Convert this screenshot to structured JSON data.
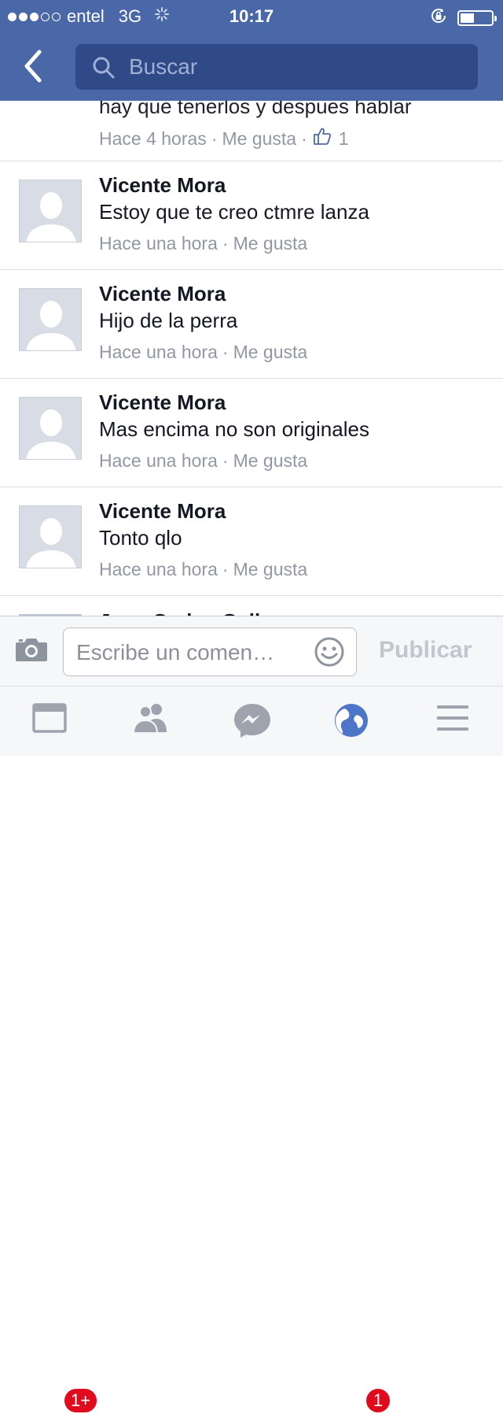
{
  "status_bar": {
    "carrier": "entel",
    "network": "3G",
    "time": "10:17",
    "signal_bars_filled": 3,
    "signal_bars_total": 5,
    "battery_level": 0.45
  },
  "nav": {
    "search_placeholder": "Buscar"
  },
  "first_comment": {
    "text": "hay que tenerlos y despues hablar",
    "time": "Hace 4 horas",
    "like_label": "Me gusta",
    "like_count": "1"
  },
  "comments": [
    {
      "author": "Vicente Mora",
      "text": "Estoy que te creo ctmre lanza",
      "time": "Hace una hora",
      "like_label": "Me gusta"
    },
    {
      "author": "Vicente Mora",
      "text": "Hijo de la perra",
      "time": "Hace una hora",
      "like_label": "Me gusta"
    },
    {
      "author": "Vicente Mora",
      "text": "Mas encima no son originales",
      "time": "Hace una hora",
      "like_label": "Me gusta"
    },
    {
      "author": "Vicente Mora",
      "text": "Tonto qlo",
      "time": "Hace una hora",
      "like_label": "Me gusta"
    }
  ],
  "partial_next": {
    "author_fragment": "Juan Carlos Galla"
  },
  "composer": {
    "placeholder": "Escribe un comen…",
    "publish_label": "Publicar"
  },
  "tab_bar": {
    "news_feed_badge": "1+",
    "notifications_badge": "1"
  },
  "colors": {
    "brand": "#4a67a8",
    "search_field": "#2f4a86",
    "meta_text": "#9197a3",
    "badge": "#e00c1d",
    "like_icon": "#4e69a2"
  },
  "icons": [
    "back-arrow-icon",
    "search-icon",
    "camera-icon",
    "smiley-icon",
    "news-feed-icon",
    "friends-icon",
    "messenger-icon",
    "globe-icon",
    "menu-icon",
    "thumbs-up-icon",
    "orientation-lock-icon",
    "activity-spinner-icon"
  ]
}
